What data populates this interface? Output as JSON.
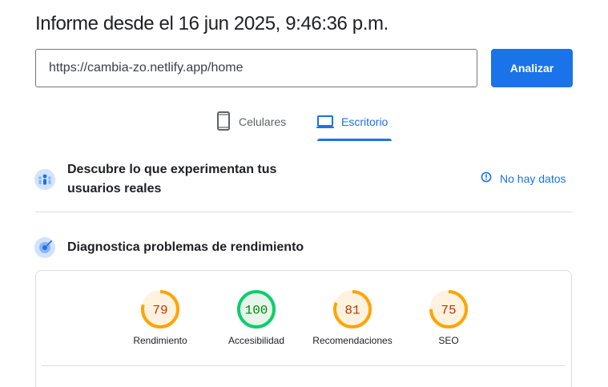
{
  "report": {
    "title": "Informe desde el 16 jun 2025, 9:46:36 p.m."
  },
  "url_bar": {
    "value": "https://cambia-zo.netlify.app/home",
    "analyze_label": "Analizar"
  },
  "device_tabs": [
    {
      "label": "Celulares",
      "icon": "smartphone-icon",
      "selected": false
    },
    {
      "label": "Escritorio",
      "icon": "laptop-icon",
      "selected": true
    }
  ],
  "crux_section": {
    "title": "Descubre lo que experimentan tus usuarios reales",
    "status": "No hay datos",
    "icon": "users-icon"
  },
  "diagnostics_section": {
    "title": "Diagnostica problemas de rendimiento",
    "icon": "lighthouse-icon"
  },
  "scores": [
    {
      "label": "Rendimiento",
      "value": 79,
      "color": "#ffa400",
      "text_color": "#c33300",
      "fill": "#fff3e0"
    },
    {
      "label": "Accesibilidad",
      "value": 100,
      "color": "#0cce6b",
      "text_color": "#008800",
      "fill": "#e6f4ea"
    },
    {
      "label": "Recomendaciones",
      "value": 81,
      "color": "#ffa400",
      "text_color": "#c33300",
      "fill": "#fff3e0"
    },
    {
      "label": "SEO",
      "value": 75,
      "color": "#ffa400",
      "text_color": "#c33300",
      "fill": "#fff3e0"
    }
  ],
  "colors": {
    "accent": "#1a73e8",
    "text_primary": "#202124",
    "text_secondary": "#5f6368",
    "divider": "#dadce0"
  }
}
